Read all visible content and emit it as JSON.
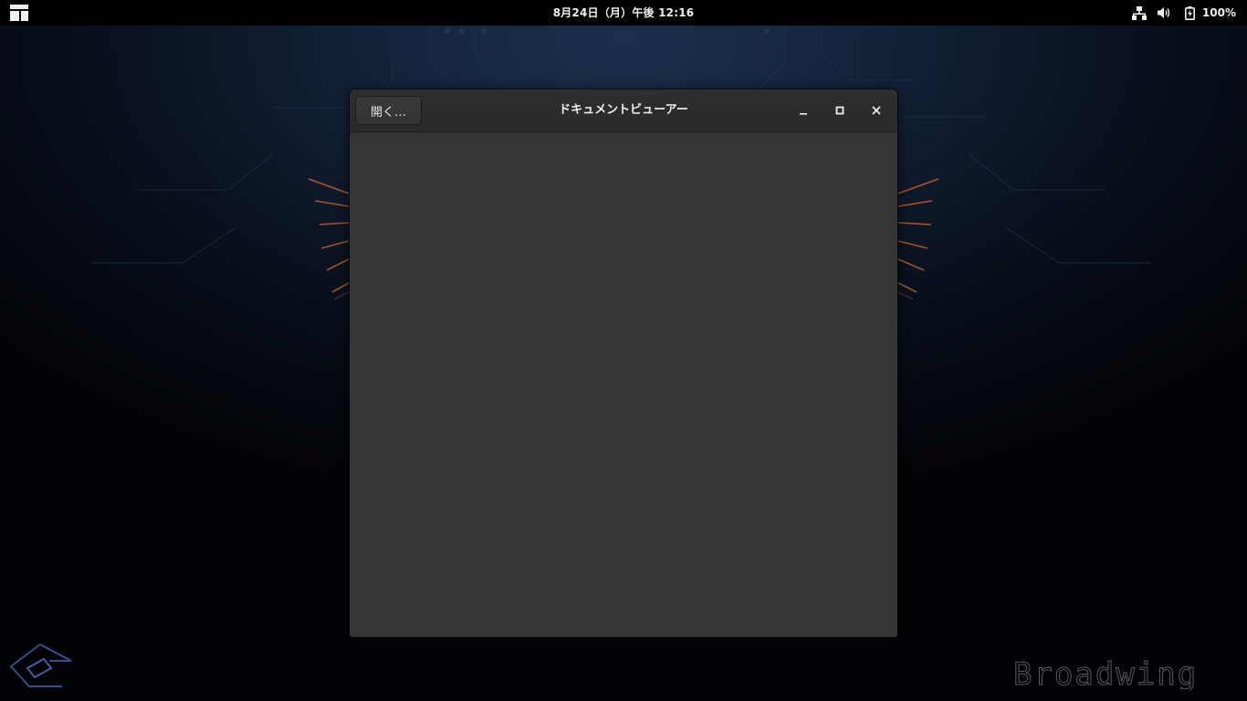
{
  "topbar": {
    "clock": "8月24日（月）午後 12:16",
    "battery_percent": "100%",
    "icons": [
      "activities-icon",
      "network-wired-icon",
      "volume-icon",
      "battery-icon"
    ]
  },
  "window": {
    "title": "ドキュメントビューアー",
    "open_button_label": "開く…",
    "controls": [
      "minimize-icon",
      "maximize-icon",
      "close-icon"
    ]
  },
  "desktop": {
    "brand_text": "Broadwing",
    "accent_color": "#c0602a",
    "background_color": "#14233a"
  }
}
